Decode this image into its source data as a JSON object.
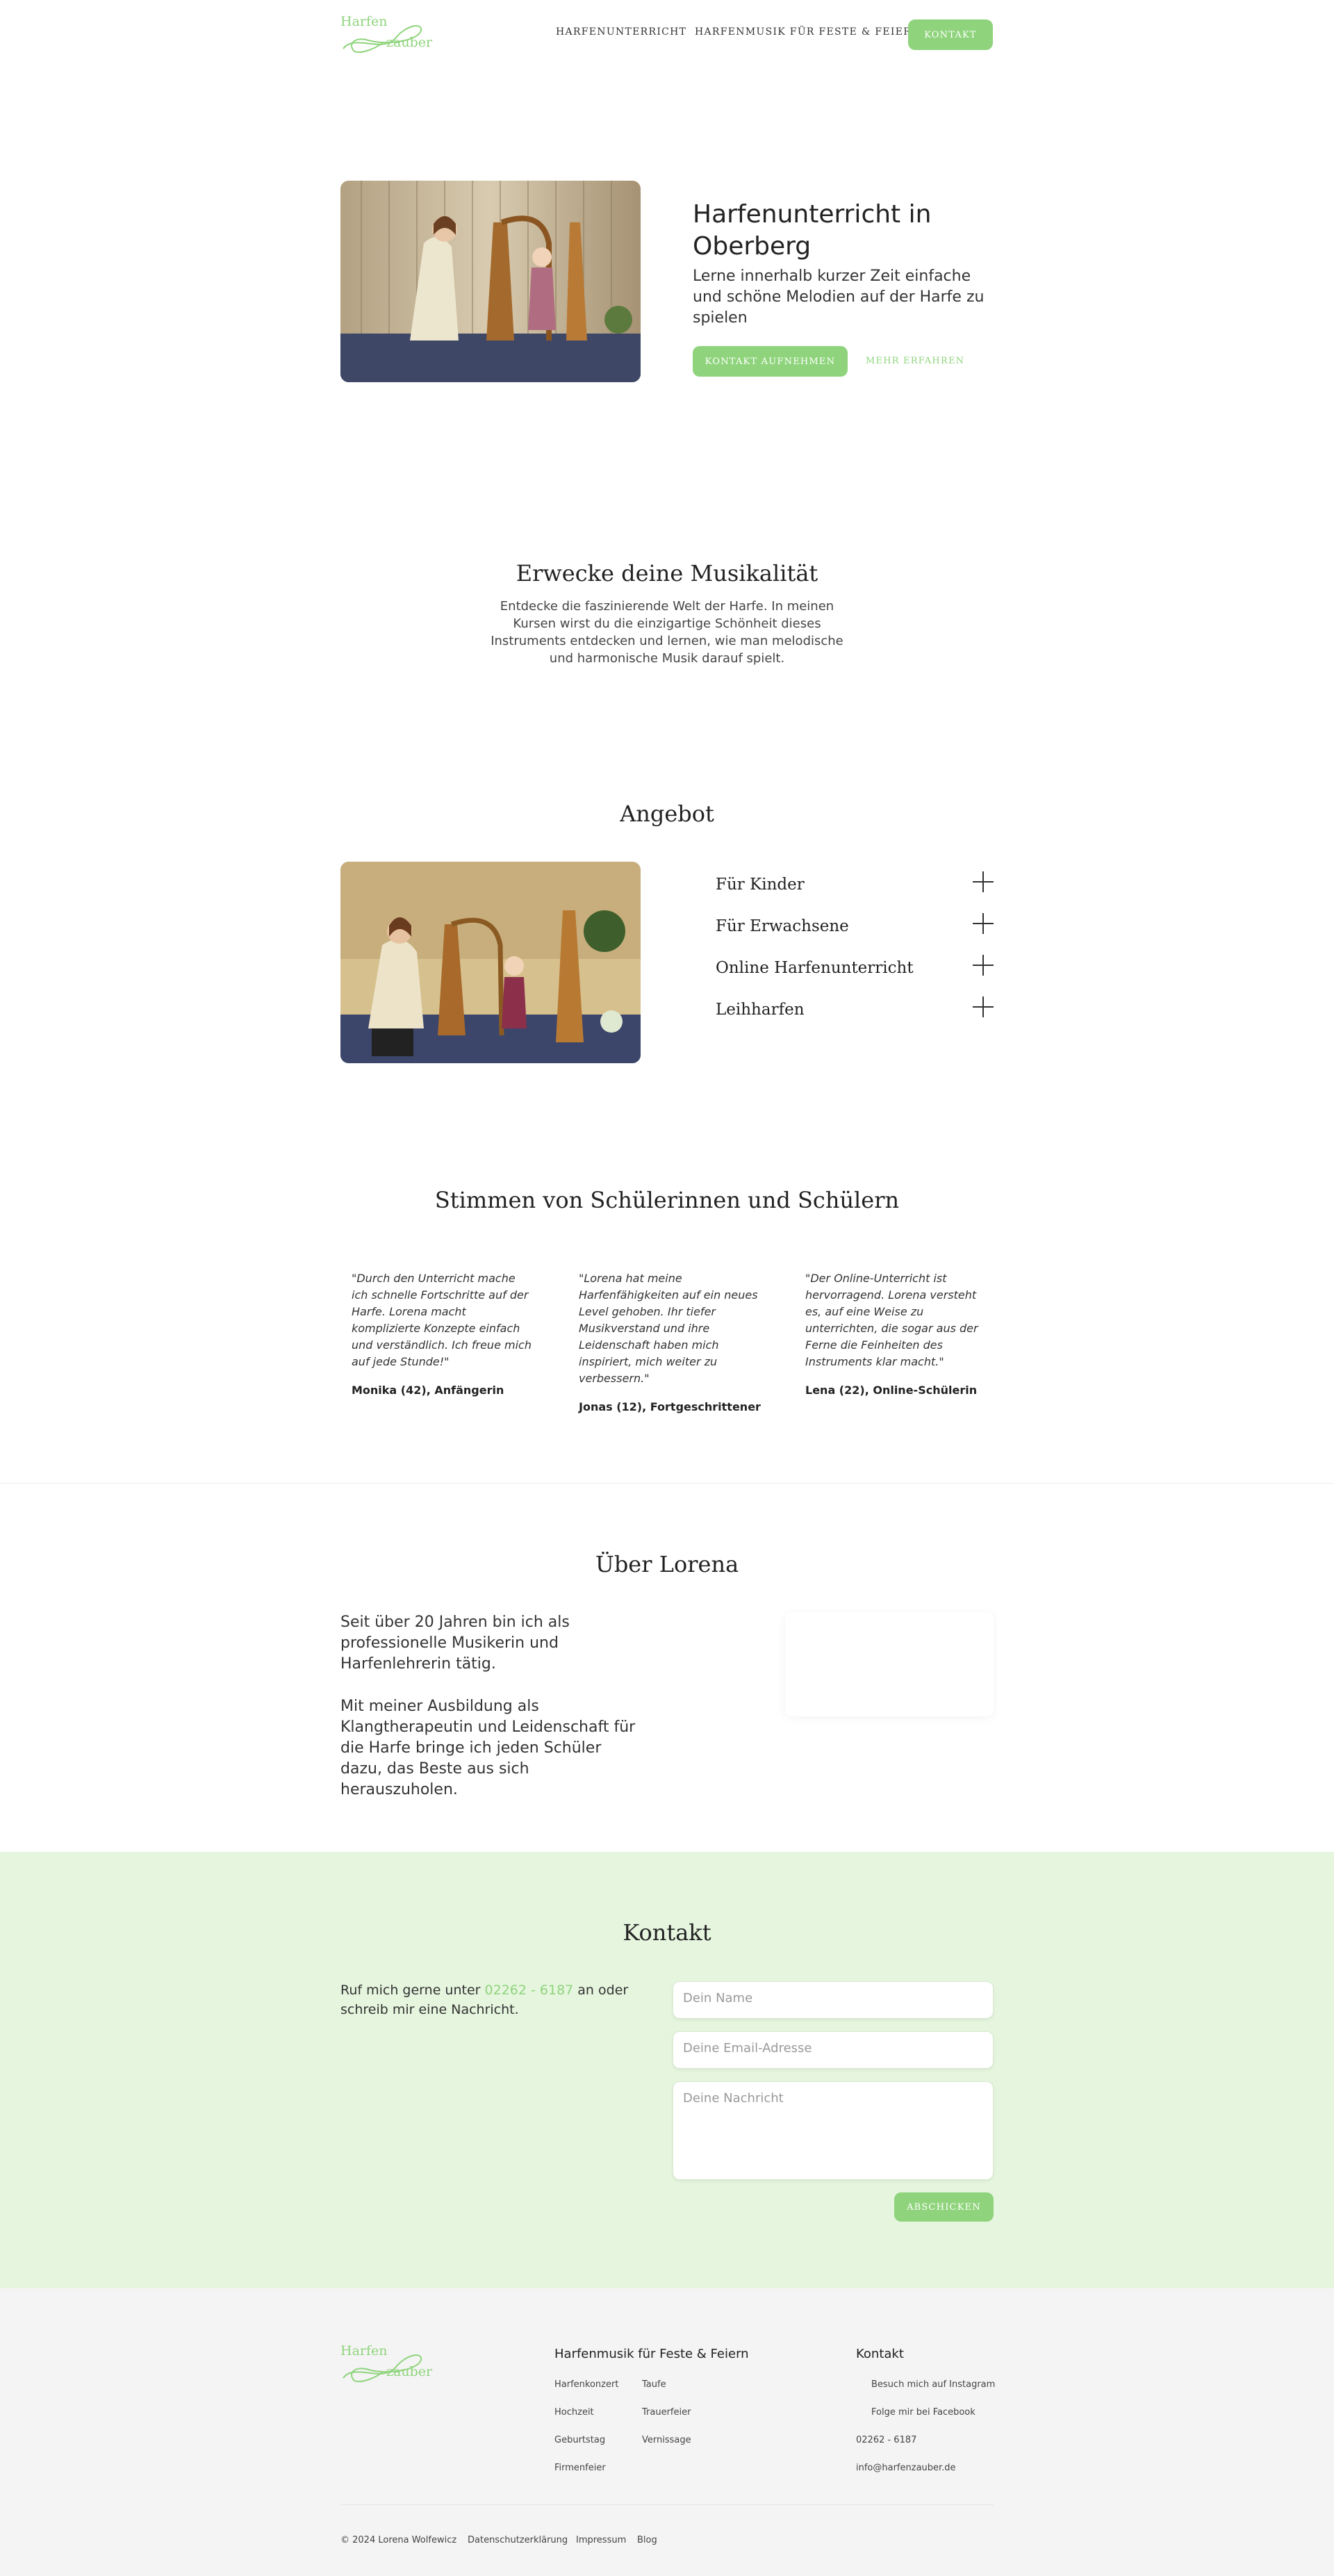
{
  "logo": {
    "word1": "Harfen",
    "word2": "zauber"
  },
  "nav": {
    "items": [
      "Harfenunterricht",
      "Harfenmusik für Feste & Feiern"
    ],
    "cta": "Kontakt"
  },
  "hero": {
    "title": "Harfenunterricht in Oberberg",
    "subtitle": "Lerne innerhalb kurzer Zeit einfache und schöne Melodien auf der Harfe zu spielen",
    "primary_button": "Kontakt aufnehmen",
    "secondary_link": "Mehr erfahren"
  },
  "intro": {
    "title": "Erwecke deine Musikalität",
    "text": "Entdecke die faszinierende Welt der Harfe. In meinen Kursen wirst du die einzigartige Schönheit dieses Instruments entdecken und lernen, wie man melodische und harmonische Musik darauf spielt."
  },
  "offer": {
    "title": "Angebot",
    "items": [
      "Für Kinder",
      "Für Erwachsene",
      "Online Harfenunterricht",
      "Leihharfen"
    ]
  },
  "testimonials": {
    "title": "Stimmen von Schülerinnen und Schülern",
    "items": [
      {
        "quote": "\"Durch den Unterricht  mache ich schnelle Fortschritte auf der Harfe. Lorena macht komplizierte Konzepte einfach und verständlich. Ich freue mich auf jede Stunde!\"",
        "author": "Monika (42), Anfängerin"
      },
      {
        "quote": "\"Lorena hat meine Harfenfähigkeiten auf ein neues Level gehoben. Ihr tiefer Musikverstand und ihre Leidenschaft haben mich inspiriert, mich weiter zu verbessern.\"",
        "author": "Jonas (12), Fortgeschrittener"
      },
      {
        "quote": "\"Der Online-Unterricht ist hervorragend. Lorena versteht es, auf eine Weise zu unterrichten, die sogar aus der Ferne die Feinheiten des Instruments klar macht.\"",
        "author": "Lena (22), Online-Schülerin"
      }
    ]
  },
  "about": {
    "title": "Über Lorena",
    "p1": "Seit über 20 Jahren bin ich als professionelle Musikerin und Harfenlehrerin tätig.",
    "p2": "Mit meiner Ausbildung als Klangtherapeutin und Leidenschaft für die Harfe bringe ich jeden Schüler dazu, das Beste aus sich herauszuholen."
  },
  "contact": {
    "title": "Kontakt",
    "text_before": "Ruf mich gerne unter ",
    "phone": "02262 - 6187",
    "text_after": " an oder schreib mir eine Nachricht.",
    "name_placeholder": "Dein Name",
    "email_placeholder": "Deine Email-Adresse",
    "message_placeholder": "Deine Nachricht",
    "submit": "Abschicken"
  },
  "footer": {
    "col1_title": "Harfenmusik für Feste & Feiern",
    "col1_left": [
      "Harfenkonzert",
      "Hochzeit",
      "Geburtstag",
      "Firmenfeier"
    ],
    "col1_right": [
      "Taufe",
      "Trauerfeier",
      "Vernissage"
    ],
    "col2_title": "Kontakt",
    "instagram": "Besuch mich auf Instagram",
    "facebook": "Folge mir bei Facebook",
    "phone": "02262 - 6187",
    "email": "info@harfenzauber.de",
    "copyright": "© 2024 Lorena Wolfewicz",
    "legal": [
      "Datenschutzerklärung",
      "Impressum",
      "Blog"
    ]
  },
  "colors": {
    "accent": "#8fd47c",
    "contact_bg": "#e5f5de",
    "footer_bg": "#f4f4f4"
  }
}
